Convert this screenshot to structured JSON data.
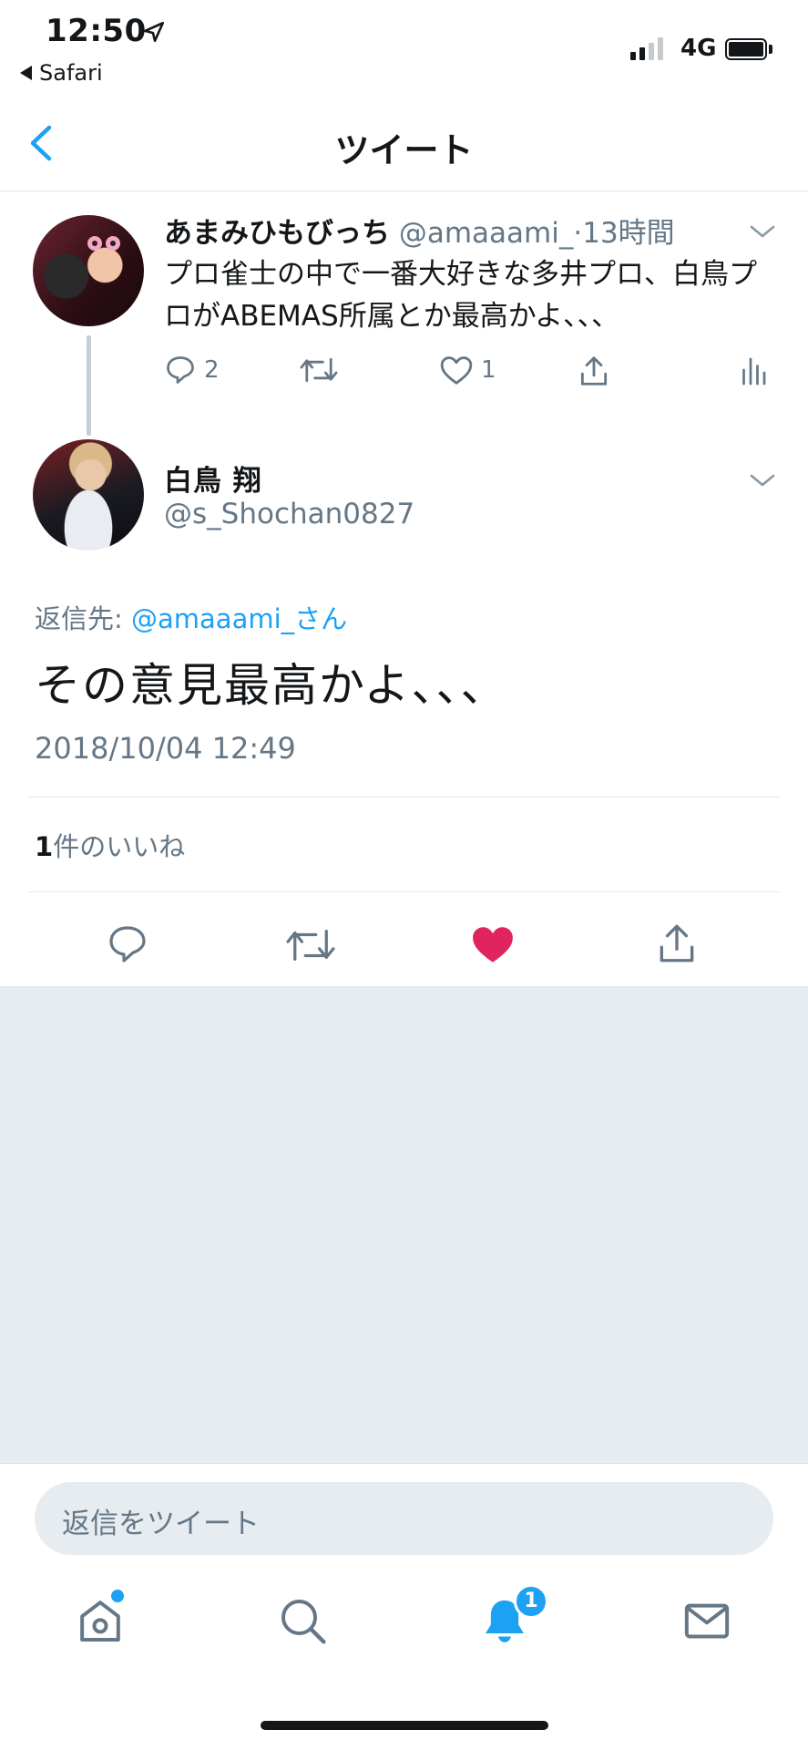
{
  "status": {
    "time": "12:50",
    "back_app": "Safari",
    "network": "4G",
    "location_icon": "location-arrow-icon",
    "battery_icon": "battery-icon"
  },
  "nav": {
    "title": "ツイート",
    "back_icon": "chevron-left-icon"
  },
  "parent_tweet": {
    "name": "あまみひもびっち",
    "handle": "@amaaami_",
    "separator": "·",
    "age": "13時間",
    "text": "プロ雀士の中で一番大好きな多井プロ、白鳥プロがABEMAS所属とか最高かよ、、、",
    "reply_count": "2",
    "like_count": "1",
    "icons": [
      "reply-icon",
      "retweet-icon",
      "like-icon",
      "share-icon",
      "analytics-icon",
      "chevron-down-icon"
    ]
  },
  "main_tweet": {
    "name": "白鳥 翔",
    "handle": "@s_Shochan0827",
    "reply_prefix": "返信先: ",
    "reply_mention": "@amaaami_さん",
    "text": "その意見最高かよ、、、",
    "timestamp": "2018/10/04 12:49",
    "likes_number": "1",
    "likes_label": "件のいいね",
    "liked": true,
    "like_color": "#e0245e"
  },
  "composer": {
    "placeholder": "返信をツイート"
  },
  "tabbar": {
    "tabs": [
      "home-icon",
      "search-icon",
      "notifications-icon",
      "messages-icon"
    ],
    "notification_badge": "1",
    "accent": "#1da1f2"
  }
}
